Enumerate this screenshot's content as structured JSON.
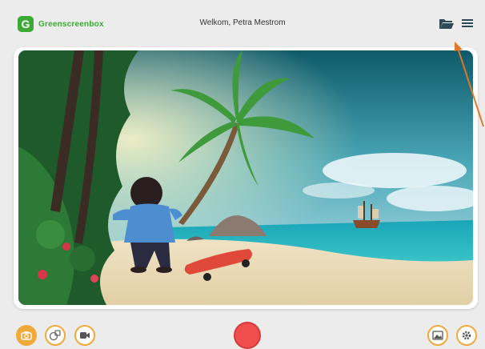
{
  "header": {
    "logo_letter": "G",
    "logo_text": "Greenscreenbox",
    "welcome": "Welkom, Petra Mestrom",
    "folder_icon": "folder-open-icon",
    "menu_icon": "hamburger-menu-icon"
  },
  "toolbar": {
    "left_buttons": [
      "camera-icon",
      "sticker-icon",
      "video-camera-icon"
    ],
    "record_button": "record-icon",
    "right_buttons": [
      "image-icon",
      "gear-icon"
    ]
  },
  "colors": {
    "brand_green": "#3aaa35",
    "accent_orange": "#f2a93b",
    "record_red": "#f04e4e",
    "background": "#ececec"
  }
}
